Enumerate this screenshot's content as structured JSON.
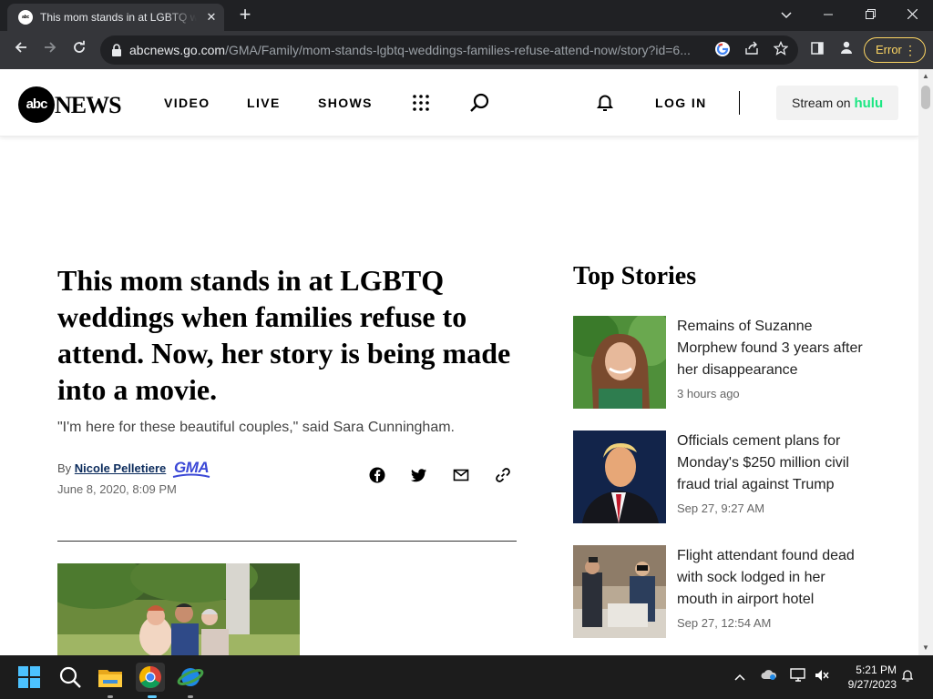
{
  "browser": {
    "tab_favicon_text": "abc",
    "tab_title": "This mom stands in at LGBTQ weddings when families refuse to attend",
    "url_host": "abcnews.go.com",
    "url_path": "/GMA/Family/mom-stands-lgbtq-weddings-families-refuse-attend-now/story?id=6...",
    "error_label": "Error"
  },
  "header": {
    "logo_mark": "abc",
    "logo_text": "NEWS",
    "nav": [
      "VIDEO",
      "LIVE",
      "SHOWS"
    ],
    "login": "LOG IN",
    "stream_prefix": "Stream on",
    "stream_brand": "hulu",
    "hulu_color": "#1ce783"
  },
  "article": {
    "headline": "This mom stands in at LGBTQ weddings when families refuse to attend. Now, her story is being made into a movie.",
    "subhead": "\"I'm here for these beautiful couples,\" said Sara Cunningham.",
    "by_prefix": "By",
    "author": "Nicole Pelletiere",
    "source_badge": "GMA",
    "date": "June 8, 2020, 8:09 PM",
    "share_icons": [
      "facebook-icon",
      "twitter-icon",
      "email-icon",
      "link-icon"
    ]
  },
  "top_stories": {
    "title": "Top Stories",
    "items": [
      {
        "title": "Remains of Suzanne Morphew found 3 years after her disappearance",
        "time": "3 hours ago"
      },
      {
        "title": "Officials cement plans for Monday's $250 million civil fraud trial against Trump",
        "time": "Sep 27, 9:27 AM"
      },
      {
        "title": "Flight attendant found dead with sock lodged in her mouth in airport hotel",
        "time": "Sep 27, 12:54 AM"
      }
    ]
  },
  "taskbar": {
    "time": "5:21 PM",
    "date": "9/27/2023",
    "pinned": [
      "windows-start-icon",
      "search-icon",
      "file-explorer-icon",
      "chrome-icon",
      "network-app-icon"
    ]
  }
}
